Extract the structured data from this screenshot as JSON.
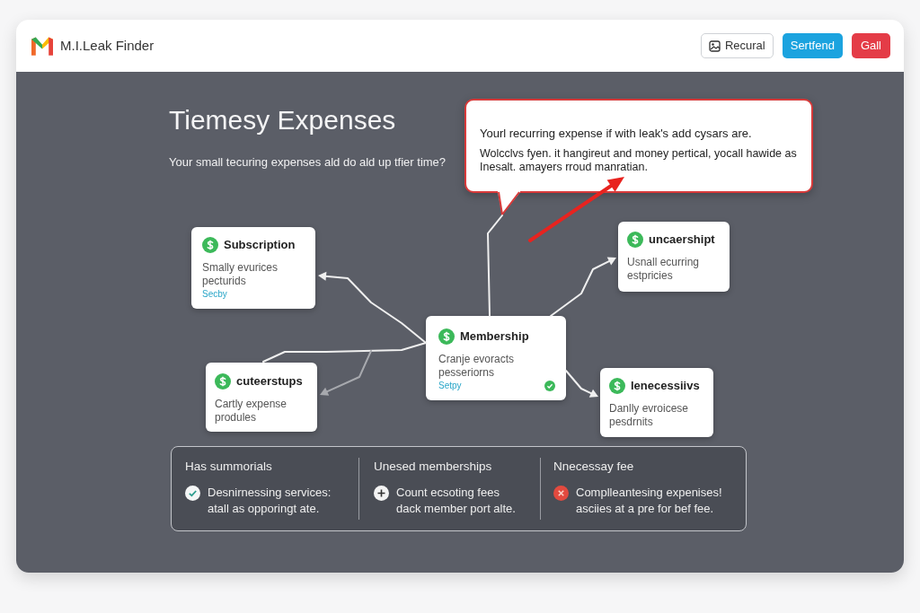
{
  "header": {
    "app_name": "M.I.Leak Finder",
    "buttons": [
      {
        "label": "Recural",
        "kind": "outline"
      },
      {
        "label": "Sertfend",
        "kind": "primary"
      },
      {
        "label": "Gall",
        "kind": "danger"
      }
    ]
  },
  "intro": {
    "title": "Tiemesy Expenses",
    "subtitle": "Your small tecuring expenses ald do ald up tfier time?"
  },
  "callout": {
    "heading": "Yourl recurring expense if with leak's add cysars are.",
    "body": "Wolcclvs fyen. it hangireut and money pertical, yocall hawide as Inesalt. amayers rroud manratian."
  },
  "diagram": {
    "nodes": [
      {
        "title": "Subscription",
        "description": "Smally evurices pecturids",
        "link": "Secby",
        "verified": false
      },
      {
        "title": "cuteerstups",
        "description": "Cartly expense produles",
        "verified": false
      },
      {
        "title": "Membership",
        "description": "Cranje evoracts pesseriorns",
        "link": "Setpy",
        "verified": true
      },
      {
        "title": "uncaershipt",
        "description": "Usnall ecurring estpricies",
        "verified": false
      },
      {
        "title": "lenecessiivs",
        "description": "Danlly evroicese pesdrnits",
        "verified": false
      }
    ]
  },
  "summary": {
    "columns": [
      {
        "heading": "Has summorials",
        "item": {
          "kind": "check",
          "text": "Desnirnessing services: atall as opporingt ate."
        }
      },
      {
        "heading": "Unesed memberships",
        "item": {
          "kind": "plus",
          "text": "Count ecsoting fees dack member port alte."
        }
      },
      {
        "heading": "Nnecessay fee",
        "item": {
          "kind": "cross",
          "text": "Complleantesing expenises! asciies at a pre for bef fee."
        }
      }
    ]
  }
}
